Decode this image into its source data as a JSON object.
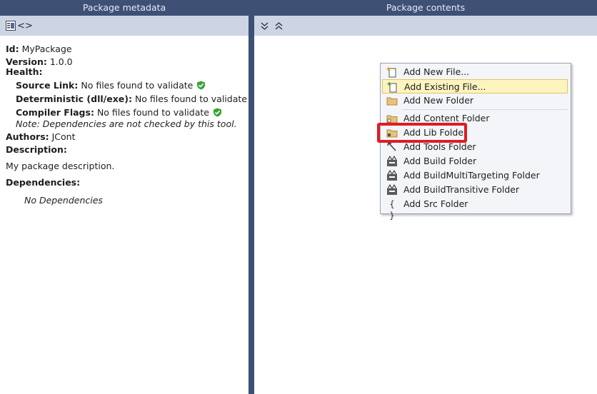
{
  "left": {
    "title": "Package metadata",
    "toolbar": [
      "properties-icon",
      "code-icon"
    ]
  },
  "right": {
    "title": "Package contents",
    "toolbar": [
      "collapse-all-icon",
      "expand-all-icon"
    ]
  },
  "metadata": {
    "id_label": "Id:",
    "id_value": "MyPackage",
    "version_label": "Version:",
    "version_value": "1.0.0",
    "health_label": "Health:",
    "source_link_label": "Source Link:",
    "source_link_value": "No files found to validate",
    "deterministic_label": "Deterministic (dll/exe):",
    "deterministic_value": "No files found to validate",
    "compiler_flags_label": "Compiler Flags:",
    "compiler_flags_value": "No files found to validate",
    "note": "Note: Dependencies are not checked by this tool.",
    "authors_label": "Authors:",
    "authors_value": "JCont",
    "description_label": "Description:",
    "description_value": "My package description.",
    "dependencies_label": "Dependencies:",
    "dependencies_value": "No Dependencies"
  },
  "menu": {
    "items": [
      {
        "label": "Add New File...",
        "icon": "new-file-icon"
      },
      {
        "label": "Add Existing File...",
        "icon": "existing-file-icon"
      },
      {
        "label": "Add New Folder",
        "icon": "folder-icon"
      },
      {
        "label": "Add Content Folder",
        "icon": "content-folder-icon"
      },
      {
        "label": "Add Lib Folder",
        "icon": "lib-folder-icon"
      },
      {
        "label": "Add Tools Folder",
        "icon": "tools-folder-icon"
      },
      {
        "label": "Add Build Folder",
        "icon": "build-folder-icon"
      },
      {
        "label": "Add BuildMultiTargeting Folder",
        "icon": "build-multitargeting-icon"
      },
      {
        "label": "Add BuildTransitive Folder",
        "icon": "build-transitive-icon"
      },
      {
        "label": "Add Src Folder",
        "icon": "braces-icon"
      }
    ]
  },
  "colors": {
    "header": "#3e5075",
    "toolbar": "#cdd5e5",
    "highlight": "#e01b24",
    "check": "#3aa335"
  }
}
